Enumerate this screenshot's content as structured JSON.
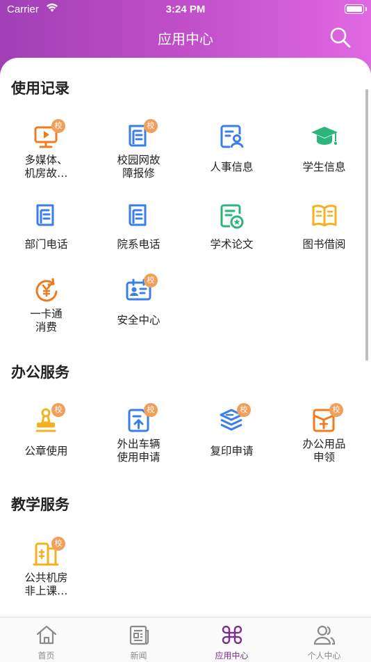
{
  "status": {
    "carrier": "Carrier",
    "time": "3:24 PM"
  },
  "header": {
    "title": "应用中心"
  },
  "badge_text": "校",
  "sections": [
    {
      "title": "使用记录"
    },
    {
      "title": "办公服务"
    },
    {
      "title": "教学服务"
    }
  ],
  "apps": {
    "media_room": "多媒体、\n机房故…",
    "campus_net": "校园网故\n障报修",
    "hr_info": "人事信息",
    "student_info": "学生信息",
    "dept_phone": "部门电话",
    "faculty_phone": "院系电话",
    "paper": "学术论文",
    "library": "图书借阅",
    "card": "一卡通\n消费",
    "safety": "安全中心",
    "seal": "公章使用",
    "vehicle": "外出车辆\n使用申请",
    "copy": "复印申请",
    "supplies": "办公用品\n申领",
    "lab": "公共机房\n非上课…"
  },
  "tabs": [
    {
      "label": "首页"
    },
    {
      "label": "新闻"
    },
    {
      "label": "应用中心"
    },
    {
      "label": "个人中心"
    }
  ],
  "colors": {
    "accent": "#7b2c8c",
    "badge": "#f1a05b",
    "blue": "#3a7ee8",
    "orange": "#f07a1e",
    "green": "#2cb57a",
    "yellow": "#f5b01f"
  }
}
